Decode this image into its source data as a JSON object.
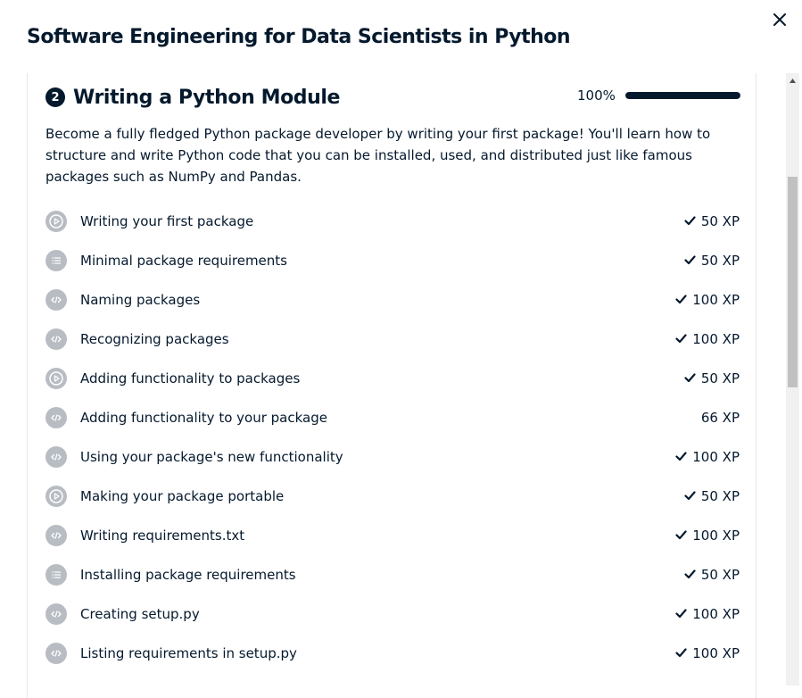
{
  "modal": {
    "title": "Software Engineering for Data Scientists in Python",
    "close_icon": "close-icon"
  },
  "chapter": {
    "number": "2",
    "title": "Writing a Python Module",
    "progress_text": "100%",
    "progress": 1.0,
    "description": "Become a fully fledged Python package developer by writing your first package! You'll learn how to structure and write Python code that you can be installed, used, and distributed just like famous packages such as NumPy and Pandas."
  },
  "lessons": [
    {
      "title": "Writing your first package",
      "xp": "50 XP",
      "icon": "video-play-icon",
      "completed": true
    },
    {
      "title": "Minimal package requirements",
      "xp": "50 XP",
      "icon": "multiple-choice-list-icon",
      "completed": true
    },
    {
      "title": "Naming packages",
      "xp": "100 XP",
      "icon": "code-exercise-icon",
      "completed": true
    },
    {
      "title": "Recognizing packages",
      "xp": "100 XP",
      "icon": "code-exercise-icon",
      "completed": true
    },
    {
      "title": "Adding functionality to packages",
      "xp": "50 XP",
      "icon": "video-play-icon",
      "completed": true
    },
    {
      "title": "Adding functionality to your package",
      "xp": "66 XP",
      "icon": "code-exercise-icon",
      "completed": false
    },
    {
      "title": "Using your package's new functionality",
      "xp": "100 XP",
      "icon": "code-exercise-icon",
      "completed": true
    },
    {
      "title": "Making your package portable",
      "xp": "50 XP",
      "icon": "video-play-icon",
      "completed": true
    },
    {
      "title": "Writing requirements.txt",
      "xp": "100 XP",
      "icon": "code-exercise-icon",
      "completed": true
    },
    {
      "title": "Installing package requirements",
      "xp": "50 XP",
      "icon": "multiple-choice-list-icon",
      "completed": true
    },
    {
      "title": "Creating setup.py",
      "xp": "100 XP",
      "icon": "code-exercise-icon",
      "completed": true
    },
    {
      "title": "Listing requirements in setup.py",
      "xp": "100 XP",
      "icon": "code-exercise-icon",
      "completed": true
    }
  ],
  "colors": {
    "text": "#05192d",
    "icon_bg": "#b8bcc3",
    "progress_track": "#d9dde2"
  }
}
